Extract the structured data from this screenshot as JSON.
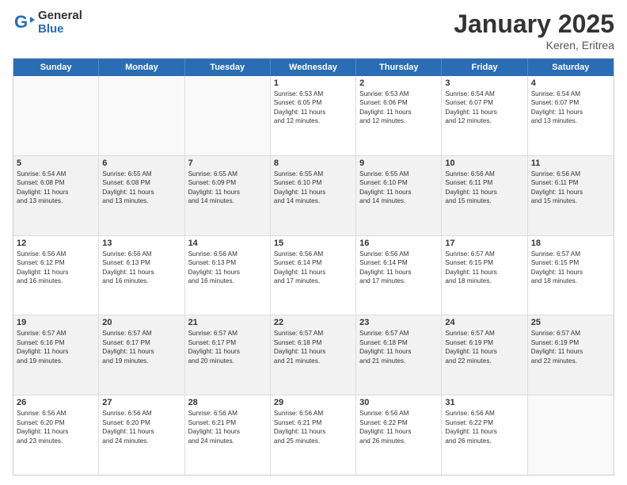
{
  "header": {
    "logo_general": "General",
    "logo_blue": "Blue",
    "title": "January 2025",
    "location": "Keren, Eritrea"
  },
  "weekdays": [
    "Sunday",
    "Monday",
    "Tuesday",
    "Wednesday",
    "Thursday",
    "Friday",
    "Saturday"
  ],
  "rows": [
    [
      {
        "day": "",
        "lines": [],
        "empty": true
      },
      {
        "day": "",
        "lines": [],
        "empty": true
      },
      {
        "day": "",
        "lines": [],
        "empty": true
      },
      {
        "day": "1",
        "lines": [
          "Sunrise: 6:53 AM",
          "Sunset: 6:05 PM",
          "Daylight: 11 hours",
          "and 12 minutes."
        ]
      },
      {
        "day": "2",
        "lines": [
          "Sunrise: 6:53 AM",
          "Sunset: 6:06 PM",
          "Daylight: 11 hours",
          "and 12 minutes."
        ]
      },
      {
        "day": "3",
        "lines": [
          "Sunrise: 6:54 AM",
          "Sunset: 6:07 PM",
          "Daylight: 11 hours",
          "and 12 minutes."
        ]
      },
      {
        "day": "4",
        "lines": [
          "Sunrise: 6:54 AM",
          "Sunset: 6:07 PM",
          "Daylight: 11 hours",
          "and 13 minutes."
        ]
      }
    ],
    [
      {
        "day": "5",
        "lines": [
          "Sunrise: 6:54 AM",
          "Sunset: 6:08 PM",
          "Daylight: 11 hours",
          "and 13 minutes."
        ],
        "shaded": true
      },
      {
        "day": "6",
        "lines": [
          "Sunrise: 6:55 AM",
          "Sunset: 6:08 PM",
          "Daylight: 11 hours",
          "and 13 minutes."
        ],
        "shaded": true
      },
      {
        "day": "7",
        "lines": [
          "Sunrise: 6:55 AM",
          "Sunset: 6:09 PM",
          "Daylight: 11 hours",
          "and 14 minutes."
        ],
        "shaded": true
      },
      {
        "day": "8",
        "lines": [
          "Sunrise: 6:55 AM",
          "Sunset: 6:10 PM",
          "Daylight: 11 hours",
          "and 14 minutes."
        ],
        "shaded": true
      },
      {
        "day": "9",
        "lines": [
          "Sunrise: 6:55 AM",
          "Sunset: 6:10 PM",
          "Daylight: 11 hours",
          "and 14 minutes."
        ],
        "shaded": true
      },
      {
        "day": "10",
        "lines": [
          "Sunrise: 6:56 AM",
          "Sunset: 6:11 PM",
          "Daylight: 11 hours",
          "and 15 minutes."
        ],
        "shaded": true
      },
      {
        "day": "11",
        "lines": [
          "Sunrise: 6:56 AM",
          "Sunset: 6:11 PM",
          "Daylight: 11 hours",
          "and 15 minutes."
        ],
        "shaded": true
      }
    ],
    [
      {
        "day": "12",
        "lines": [
          "Sunrise: 6:56 AM",
          "Sunset: 6:12 PM",
          "Daylight: 11 hours",
          "and 16 minutes."
        ]
      },
      {
        "day": "13",
        "lines": [
          "Sunrise: 6:56 AM",
          "Sunset: 6:13 PM",
          "Daylight: 11 hours",
          "and 16 minutes."
        ]
      },
      {
        "day": "14",
        "lines": [
          "Sunrise: 6:56 AM",
          "Sunset: 6:13 PM",
          "Daylight: 11 hours",
          "and 16 minutes."
        ]
      },
      {
        "day": "15",
        "lines": [
          "Sunrise: 6:56 AM",
          "Sunset: 6:14 PM",
          "Daylight: 11 hours",
          "and 17 minutes."
        ]
      },
      {
        "day": "16",
        "lines": [
          "Sunrise: 6:56 AM",
          "Sunset: 6:14 PM",
          "Daylight: 11 hours",
          "and 17 minutes."
        ]
      },
      {
        "day": "17",
        "lines": [
          "Sunrise: 6:57 AM",
          "Sunset: 6:15 PM",
          "Daylight: 11 hours",
          "and 18 minutes."
        ]
      },
      {
        "day": "18",
        "lines": [
          "Sunrise: 6:57 AM",
          "Sunset: 6:15 PM",
          "Daylight: 11 hours",
          "and 18 minutes."
        ]
      }
    ],
    [
      {
        "day": "19",
        "lines": [
          "Sunrise: 6:57 AM",
          "Sunset: 6:16 PM",
          "Daylight: 11 hours",
          "and 19 minutes."
        ],
        "shaded": true
      },
      {
        "day": "20",
        "lines": [
          "Sunrise: 6:57 AM",
          "Sunset: 6:17 PM",
          "Daylight: 11 hours",
          "and 19 minutes."
        ],
        "shaded": true
      },
      {
        "day": "21",
        "lines": [
          "Sunrise: 6:57 AM",
          "Sunset: 6:17 PM",
          "Daylight: 11 hours",
          "and 20 minutes."
        ],
        "shaded": true
      },
      {
        "day": "22",
        "lines": [
          "Sunrise: 6:57 AM",
          "Sunset: 6:18 PM",
          "Daylight: 11 hours",
          "and 21 minutes."
        ],
        "shaded": true
      },
      {
        "day": "23",
        "lines": [
          "Sunrise: 6:57 AM",
          "Sunset: 6:18 PM",
          "Daylight: 11 hours",
          "and 21 minutes."
        ],
        "shaded": true
      },
      {
        "day": "24",
        "lines": [
          "Sunrise: 6:57 AM",
          "Sunset: 6:19 PM",
          "Daylight: 11 hours",
          "and 22 minutes."
        ],
        "shaded": true
      },
      {
        "day": "25",
        "lines": [
          "Sunrise: 6:57 AM",
          "Sunset: 6:19 PM",
          "Daylight: 11 hours",
          "and 22 minutes."
        ],
        "shaded": true
      }
    ],
    [
      {
        "day": "26",
        "lines": [
          "Sunrise: 6:56 AM",
          "Sunset: 6:20 PM",
          "Daylight: 11 hours",
          "and 23 minutes."
        ]
      },
      {
        "day": "27",
        "lines": [
          "Sunrise: 6:56 AM",
          "Sunset: 6:20 PM",
          "Daylight: 11 hours",
          "and 24 minutes."
        ]
      },
      {
        "day": "28",
        "lines": [
          "Sunrise: 6:56 AM",
          "Sunset: 6:21 PM",
          "Daylight: 11 hours",
          "and 24 minutes."
        ]
      },
      {
        "day": "29",
        "lines": [
          "Sunrise: 6:56 AM",
          "Sunset: 6:21 PM",
          "Daylight: 11 hours",
          "and 25 minutes."
        ]
      },
      {
        "day": "30",
        "lines": [
          "Sunrise: 6:56 AM",
          "Sunset: 6:22 PM",
          "Daylight: 11 hours",
          "and 26 minutes."
        ]
      },
      {
        "day": "31",
        "lines": [
          "Sunrise: 6:56 AM",
          "Sunset: 6:22 PM",
          "Daylight: 11 hours",
          "and 26 minutes."
        ]
      },
      {
        "day": "",
        "lines": [],
        "empty": true
      }
    ]
  ]
}
